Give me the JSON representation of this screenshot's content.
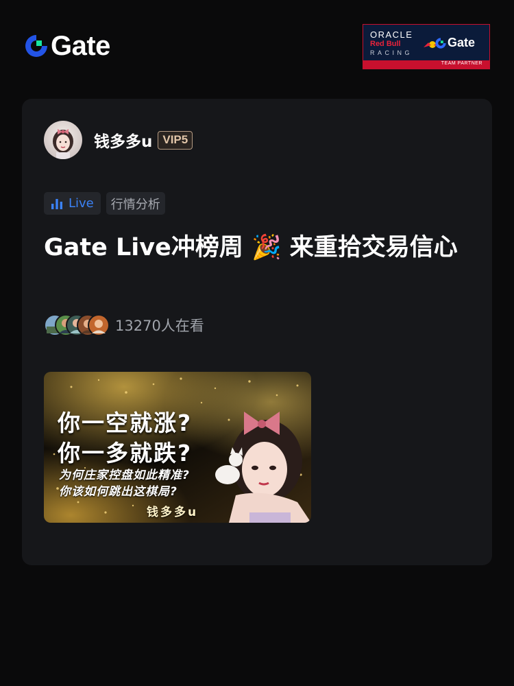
{
  "header": {
    "brand_name": "Gate",
    "partner": {
      "oracle": "ORACLE",
      "redbull": "Red Bull",
      "racing": "RACING",
      "gate": "Gate",
      "badge": "TEAM PARTNER"
    }
  },
  "post": {
    "author": {
      "name": "钱多多u",
      "vip": "VIP5",
      "avatar_icon": "avatar-girl"
    },
    "tags": [
      {
        "label": "Live",
        "icon": "bar-chart-icon"
      },
      {
        "label": "行情分析"
      }
    ],
    "title": "Gate Live冲榜周 🎉 来重拾交易信心",
    "viewers": "13270人在看",
    "cover": {
      "line1": "你一空就涨?",
      "line2": "你一多就跌?",
      "line3": "为何庄家控盘如此精准?",
      "line4": "你该如何跳出这棋局?",
      "signature": "钱多多u"
    }
  },
  "colors": {
    "background": "#0a0a0b",
    "card": "#16171a",
    "accent_blue": "#3b82f6",
    "brand_green": "#17e6a1",
    "vip_gold": "#e2c6a9"
  }
}
